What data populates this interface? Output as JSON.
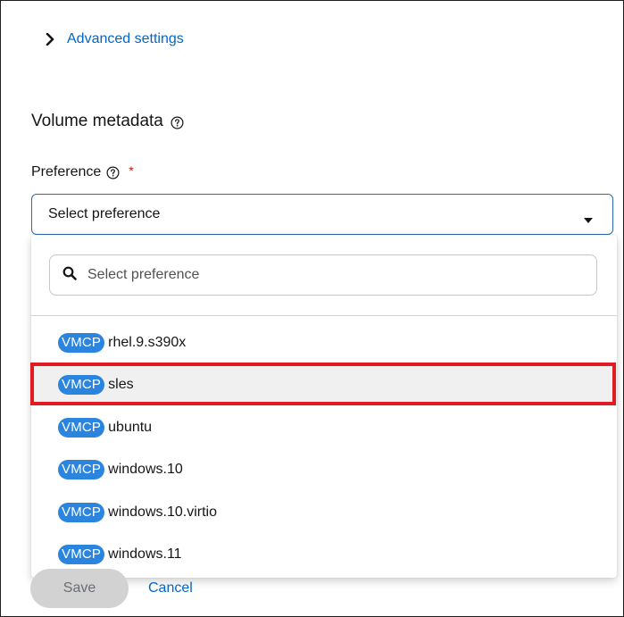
{
  "advanced_settings": {
    "label": "Advanced settings",
    "icon": "chevron-right-icon"
  },
  "volume_metadata": {
    "title": "Volume metadata",
    "help_icon": "help-circle-icon"
  },
  "preference": {
    "label": "Preference",
    "required_marker": "*",
    "select_value": "Select preference",
    "search_placeholder": "Select preference",
    "options": [
      {
        "badge": "VMCP",
        "name": "rhel.9.s390x"
      },
      {
        "badge": "VMCP",
        "name": "sles",
        "highlighted": true
      },
      {
        "badge": "VMCP",
        "name": "ubuntu"
      },
      {
        "badge": "VMCP",
        "name": "windows.10"
      },
      {
        "badge": "VMCP",
        "name": "windows.10.virtio"
      },
      {
        "badge": "VMCP",
        "name": "windows.11"
      }
    ]
  },
  "footer": {
    "save_label": "Save",
    "cancel_label": "Cancel"
  },
  "colors": {
    "link": "#0066cc",
    "badge": "#2b84de",
    "focus_border": "#2b6cb0",
    "highlight_box": "#e21b22",
    "required": "#c9190b"
  }
}
